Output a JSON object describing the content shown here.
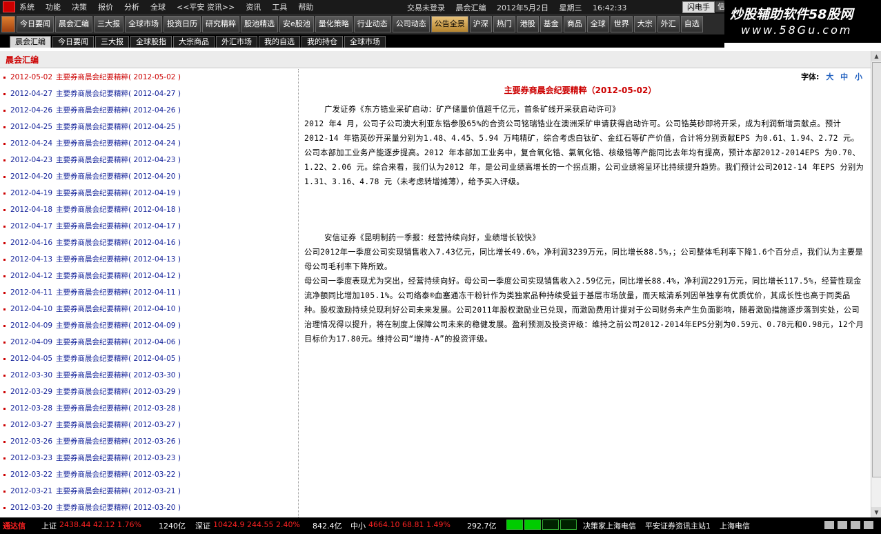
{
  "menu": {
    "items": [
      "系统",
      "功能",
      "决策",
      "报价",
      "分析",
      "全球",
      "<<平安 资讯>>",
      "资讯",
      "工具",
      "帮助"
    ],
    "login": "交易未登录",
    "section": "晨会汇编",
    "date": "2012年5月2日",
    "weekday": "星期三",
    "time": "16:42:33",
    "flash_label": "闪电手",
    "flash2_label": "信"
  },
  "watermark": {
    "line1": "炒股辅助软件58股网",
    "line2": "www.58Gu.com"
  },
  "toolbar": {
    "buttons": [
      "今日要闻",
      "晨会汇编",
      "三大报",
      "全球市场",
      "投资日历",
      "研究精粹",
      "股池精选",
      "安e股池",
      "量化策略",
      "行业动态",
      "公司动态",
      "公告全景",
      "沪深",
      "热门",
      "港股",
      "基金",
      "商品",
      "全球",
      "世界",
      "大宗",
      "外汇",
      "自选"
    ]
  },
  "subtabs": [
    "晨会汇编",
    "今日要闻",
    "三大报",
    "全球股指",
    "大宗商品",
    "外汇市场",
    "我的自选",
    "我的持仓",
    "全球市场"
  ],
  "panel_title": "晨会汇编",
  "list": [
    {
      "date": "2012-05-02",
      "title": "主要券商晨会纪要精粹",
      "paren": "( 2012-05-02 )"
    },
    {
      "date": "2012-04-27",
      "title": "主要券商晨会纪要精粹",
      "paren": "( 2012-04-27 )"
    },
    {
      "date": "2012-04-26",
      "title": "主要券商晨会纪要精粹",
      "paren": "( 2012-04-26 )"
    },
    {
      "date": "2012-04-25",
      "title": "主要券商晨会纪要精粹",
      "paren": "( 2012-04-25 )"
    },
    {
      "date": "2012-04-24",
      "title": "主要券商晨会纪要精粹",
      "paren": "( 2012-04-24 )"
    },
    {
      "date": "2012-04-23",
      "title": "主要券商晨会纪要精粹",
      "paren": "( 2012-04-23 )"
    },
    {
      "date": "2012-04-20",
      "title": "主要券商晨会纪要精粹",
      "paren": "( 2012-04-20 )"
    },
    {
      "date": "2012-04-19",
      "title": "主要券商晨会纪要精粹",
      "paren": "( 2012-04-19 )"
    },
    {
      "date": "2012-04-18",
      "title": "主要券商晨会纪要精粹",
      "paren": "( 2012-04-18 )"
    },
    {
      "date": "2012-04-17",
      "title": "主要券商晨会纪要精粹",
      "paren": "( 2012-04-17 )"
    },
    {
      "date": "2012-04-16",
      "title": "主要券商晨会纪要精粹",
      "paren": "( 2012-04-16 )"
    },
    {
      "date": "2012-04-13",
      "title": "主要券商晨会纪要精粹",
      "paren": "( 2012-04-13 )"
    },
    {
      "date": "2012-04-12",
      "title": "主要券商晨会纪要精粹",
      "paren": "( 2012-04-12 )"
    },
    {
      "date": "2012-04-11",
      "title": "主要券商晨会纪要精粹",
      "paren": "( 2012-04-11 )"
    },
    {
      "date": "2012-04-10",
      "title": "主要券商晨会纪要精粹",
      "paren": "( 2012-04-10 )"
    },
    {
      "date": "2012-04-09",
      "title": "主要券商晨会纪要精粹",
      "paren": "( 2012-04-09 )"
    },
    {
      "date": "2012-04-09",
      "title": "主要券商晨会纪要精粹",
      "paren": "( 2012-04-06 )"
    },
    {
      "date": "2012-04-05",
      "title": "主要券商晨会纪要精粹",
      "paren": "( 2012-04-05 )"
    },
    {
      "date": "2012-03-30",
      "title": "主要券商晨会纪要精粹",
      "paren": "( 2012-03-30 )"
    },
    {
      "date": "2012-03-29",
      "title": "主要券商晨会纪要精粹",
      "paren": "( 2012-03-29 )"
    },
    {
      "date": "2012-03-28",
      "title": "主要券商晨会纪要精粹",
      "paren": "( 2012-03-28 )"
    },
    {
      "date": "2012-03-27",
      "title": "主要券商晨会纪要精粹",
      "paren": "( 2012-03-27 )"
    },
    {
      "date": "2012-03-26",
      "title": "主要券商晨会纪要精粹",
      "paren": "( 2012-03-26 )"
    },
    {
      "date": "2012-03-23",
      "title": "主要券商晨会纪要精粹",
      "paren": "( 2012-03-23 )"
    },
    {
      "date": "2012-03-22",
      "title": "主要券商晨会纪要精粹",
      "paren": "( 2012-03-22 )"
    },
    {
      "date": "2012-03-21",
      "title": "主要券商晨会纪要精粹",
      "paren": "( 2012-03-21 )"
    },
    {
      "date": "2012-03-20",
      "title": "主要券商晨会纪要精粹",
      "paren": "( 2012-03-20 )"
    }
  ],
  "article": {
    "font_label": "字体:",
    "font_sizes": [
      "大",
      "中",
      "小"
    ],
    "title": "主要券商晨会纪要精粹（2012-05-02）",
    "sec1_head": "广发证券《东方锆业采矿启动：矿产储量价值超千亿元，首条矿线开采获启动许可》",
    "sec1_body": "2012 年4 月，公司子公司澳大利亚东锆参股65%的合资公司铭瑞锆业在澳洲采矿申请获得启动许可。公司锆英砂即将开采，成为利润新增贡献点。预计2012-14 年锆英砂开采量分别为1.48、4.45、5.94 万吨精矿，综合考虑白钛矿、金红石等矿产价值，合计将分别贡献EPS 为0.61、1.94、2.72 元。公司本部加工业务产能逐步提高。2012 年本部加工业务中，复合氧化锆、氯氧化锆、核级锆等产能同比去年均有提高，预计本部2012-2014EPS 为0.70、1.22、2.06 元。综合来看，我们认为2012 年，是公司业绩高增长的一个拐点期，公司业绩将呈环比持续提升趋势。我们预计公司2012-14 年EPS 分别为1.31、3.16、4.78 元（未考虑转增摊薄），给予买入评级。",
    "sec2_head": "安信证券《昆明制药一季报：经营持续向好，业绩增长较快》",
    "sec2_p1": "公司2012年一季度公司实现销售收入7.43亿元，同比增长49.6%，净利润3239万元，同比增长88.5%，；公司整体毛利率下降1.6个百分点，我们认为主要是母公司毛利率下降所致。",
    "sec2_p2": "母公司一季度表现尤为突出，经营持续向好。母公司一季度公司实现销售收入2.59亿元，同比增长88.4%，净利润2291万元，同比增长117.5%，经营性现金流净额同比增加105.1%。公司络泰®血塞通冻干粉针作为类独家品种持续受益于基层市场放量，而天眩清系列因单独享有优质优价，其成长性也高于同类品种。股权激励持续兑现利好公司未来发展。公司2011年股权激励业已兑现，而激励费用计提对于公司财务未产生负面影响，随着激励措施逐步落到实处，公司治理情况得以提升，将在制度上保障公司未来的稳健发展。盈利预测及投资评级：维持之前公司2012-2014年EPS分别为0.59元、0.78元和0.98元，12个月目标价为17.80元。维持公司“增持-A”的投资评级。"
  },
  "status": {
    "brand": "通达信",
    "sh_label": "上证",
    "sh_vals": "2438.44  42.12  1.76%",
    "sh_amt": "1240亿",
    "sz_label": "深证",
    "sz_vals": "10424.9  244.55  2.40%",
    "sz_amt": "842.4亿",
    "zx_label": "中小",
    "zx_vals": "4664.10  68.81  1.49%",
    "zx_amt": "292.7亿",
    "info1": "决策家上海电信",
    "info2": "平安证券资讯主站1",
    "info3": "上海电信"
  },
  "colors": {
    "accent_red": "#cc0000",
    "link_blue": "#14239a",
    "bar_bg": "#000000"
  }
}
